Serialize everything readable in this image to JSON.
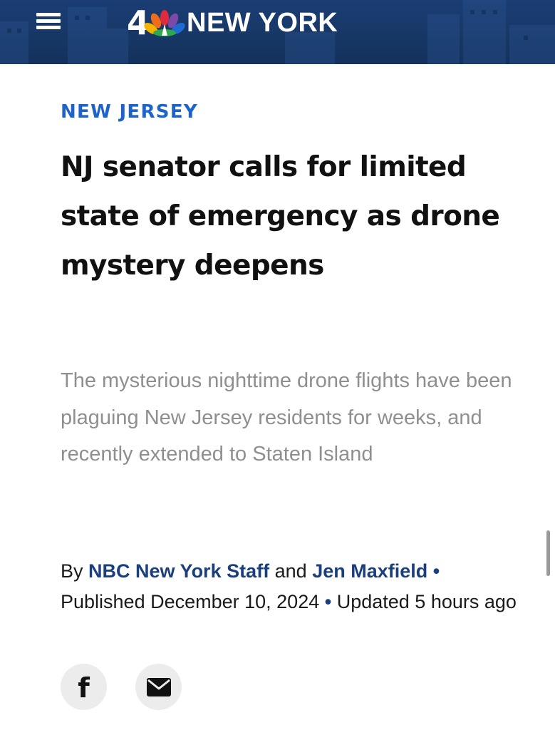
{
  "header": {
    "menu_icon": "hamburger-menu-icon",
    "brand": {
      "channel_number": "4",
      "logo_icon": "nbc-peacock-icon",
      "station_name": "NEW YORK"
    },
    "colors": {
      "background": "#173866",
      "text": "#ffffff"
    }
  },
  "article": {
    "category": "NEW JERSEY",
    "headline": "NJ senator calls for limited state of emergency as drone mystery deepens",
    "dek": "The mysterious nighttime drone flights have been plaguing New Jersey residents for weeks, and recently extended to Staten Island",
    "byline": {
      "prefix": "By",
      "author_1": "NBC New York Staff",
      "conjunction": "and",
      "author_2": "Jen Maxfield",
      "separator": "•",
      "published": "Published December 10, 2024",
      "updated": "Updated 5 hours ago"
    },
    "colors": {
      "category": "#1e63c9",
      "headline": "#111111",
      "dek": "#8f8f8f",
      "author_link": "#1b3f7c"
    }
  },
  "share": {
    "facebook_icon_glyph": "f",
    "facebook_icon": "facebook-icon",
    "email_icon": "email-envelope-icon"
  }
}
